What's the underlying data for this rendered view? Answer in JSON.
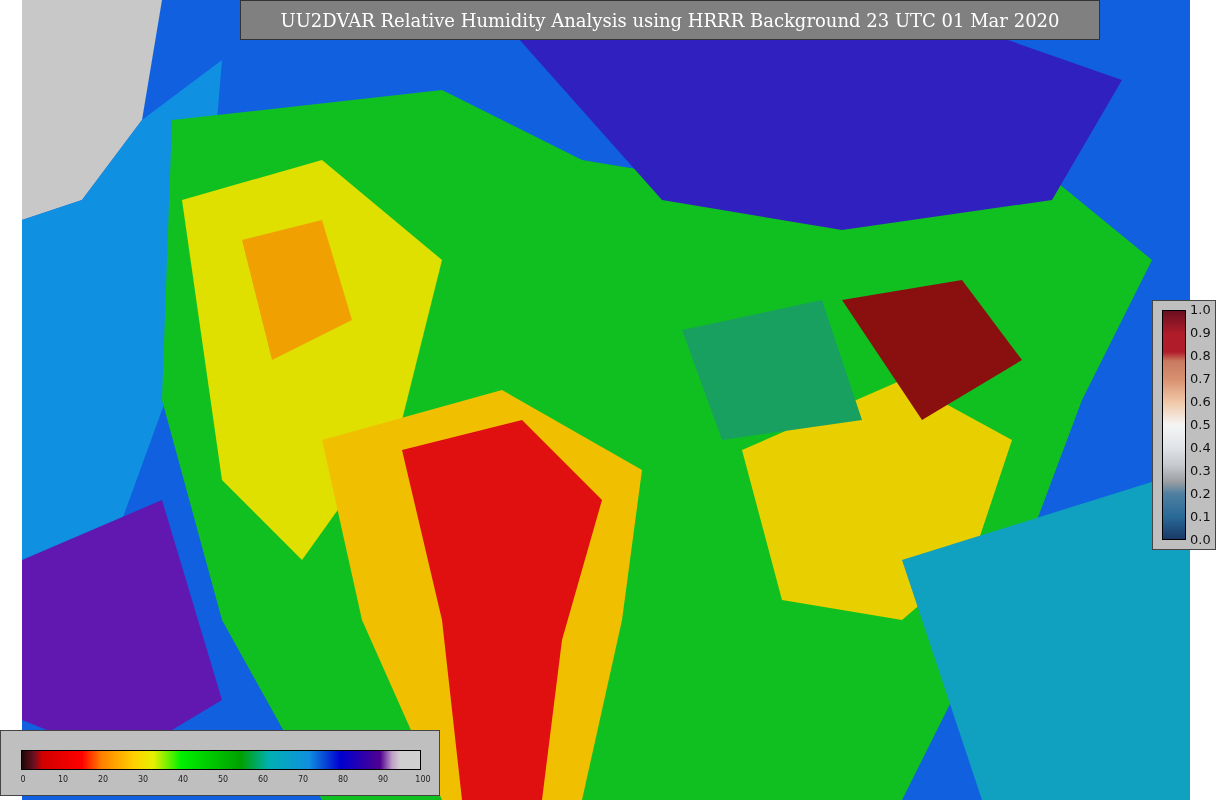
{
  "title": "UU2DVAR Relative Humidity Analysis using HRRR Background 23 UTC 01 Mar 2020",
  "weight_legend": {
    "ticks": [
      "1.0",
      "0.9",
      "0.8",
      "0.7",
      "0.6",
      "0.5",
      "0.4",
      "0.3",
      "0.2",
      "0.1",
      "0.0"
    ]
  },
  "humidity_legend": {
    "ticks": [
      "0",
      "10",
      "20",
      "30",
      "40",
      "50",
      "60",
      "70",
      "80",
      "90",
      "100"
    ]
  }
}
